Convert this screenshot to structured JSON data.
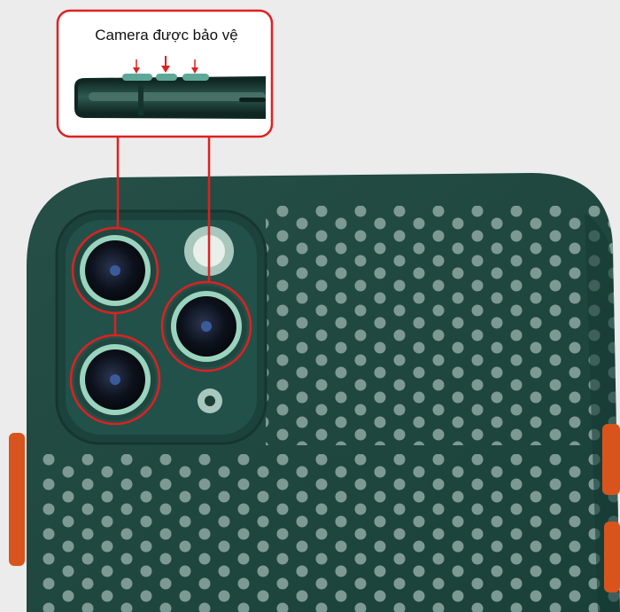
{
  "callout": {
    "label": "Camera được bảo vệ"
  },
  "colors": {
    "background": "#ececec",
    "case_green": "#1f4a42",
    "hole_light": "#7a9a92",
    "lens_ring": "#9bd4be",
    "highlight_red": "#e02020",
    "button_orange": "#d9541c"
  }
}
